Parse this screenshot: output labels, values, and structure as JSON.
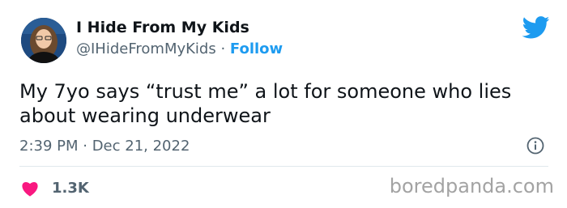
{
  "tweet": {
    "author_name": "I Hide From My Kids",
    "handle": "@IHideFromMyKids",
    "separator": " · ",
    "follow_label": "Follow",
    "text": "My 7yo says “trust me” a lot for someone who lies about wearing underwear",
    "timestamp": "2:39 PM · Dec 21, 2022",
    "like_count": "1.3K"
  },
  "icons": {
    "platform": "twitter-bird-icon",
    "info": "info-icon",
    "like": "heart-icon"
  },
  "colors": {
    "accent": "#1d9bf0",
    "heart": "#f91880",
    "text": "#0f1419",
    "secondary": "#536471"
  },
  "watermark": "boredpanda.com"
}
